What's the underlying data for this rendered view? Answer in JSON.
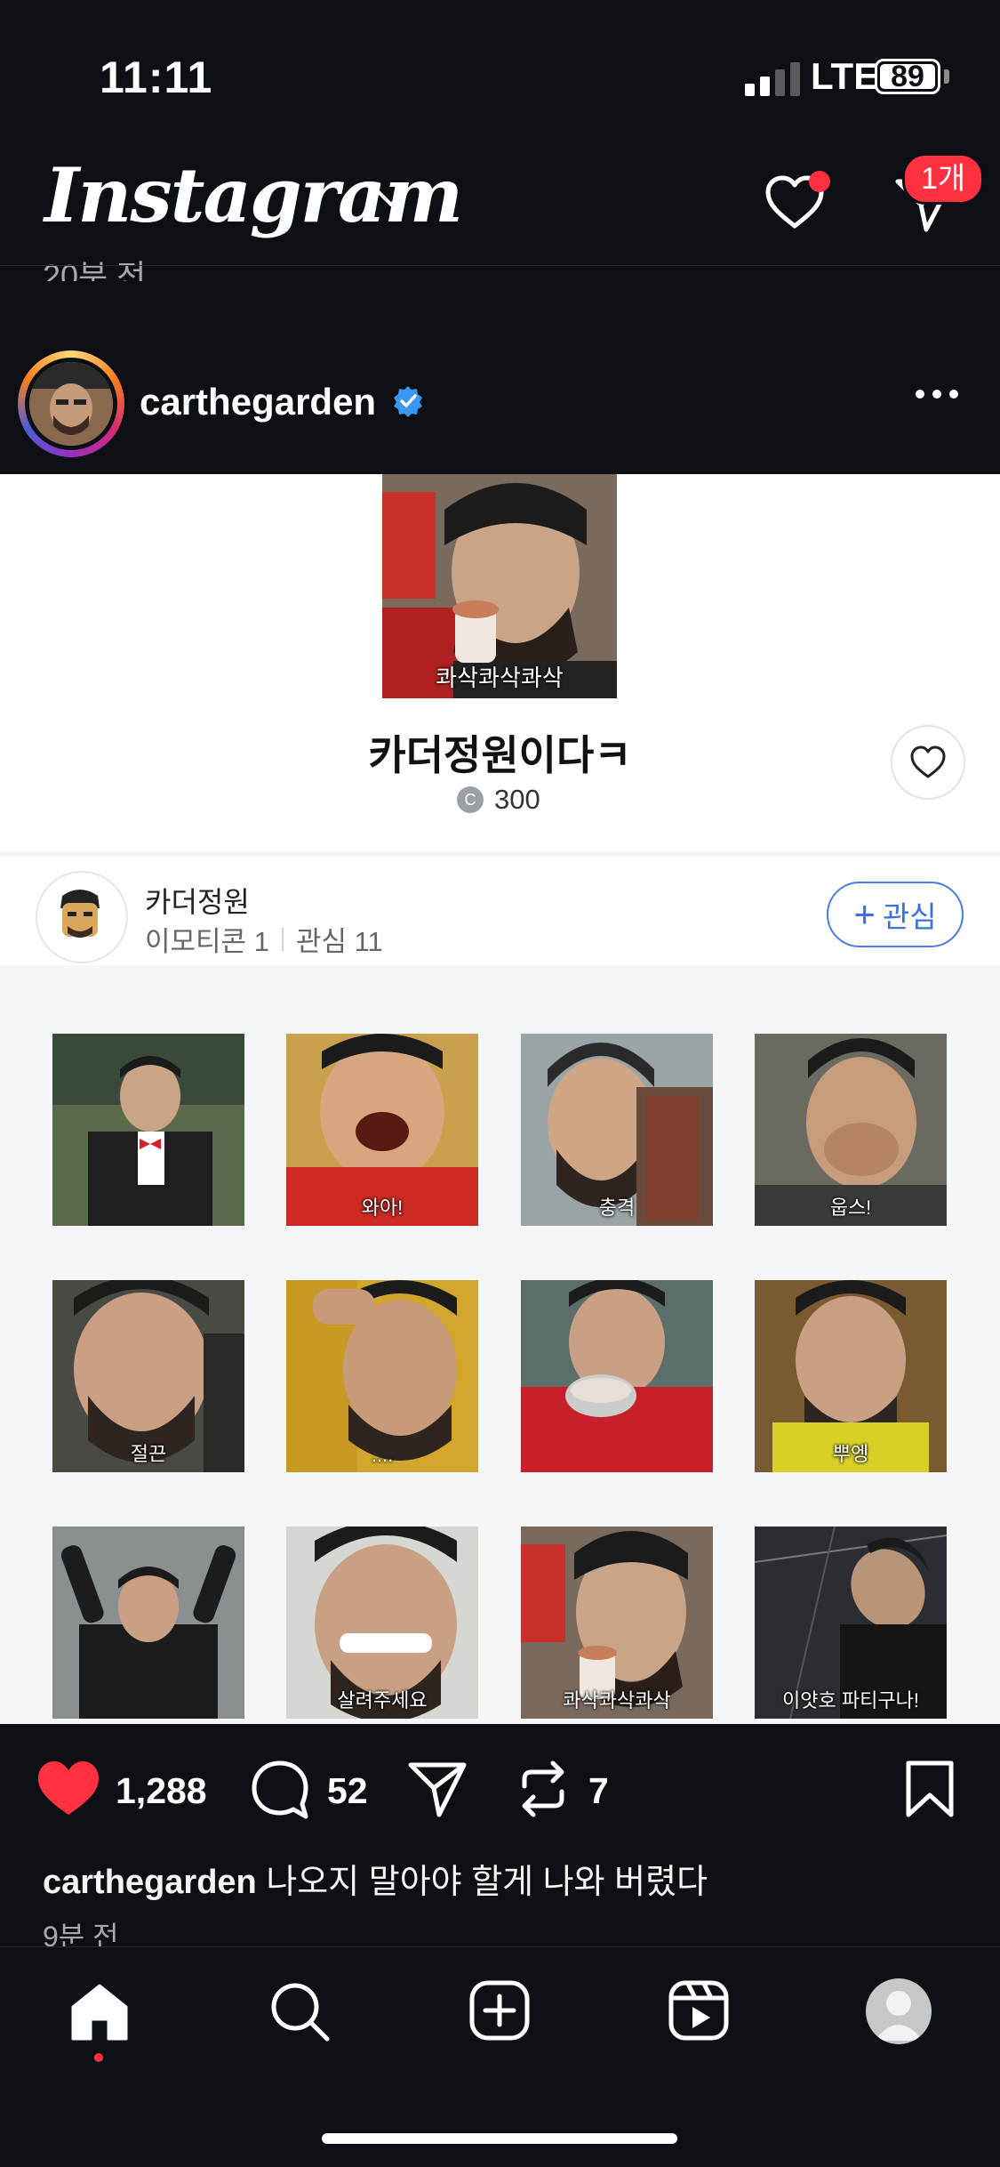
{
  "status_bar": {
    "time": "11:11",
    "network": "LTE",
    "battery": "89"
  },
  "header": {
    "logo": "Instagram",
    "dm_badge": "1개"
  },
  "feed": {
    "previous_post_time": "20분 전"
  },
  "post": {
    "username": "carthegarden",
    "emoticon_card": {
      "hero_caption": "콰삭콰삭콰삭",
      "title": "카더정원이다ㅋ",
      "price": "300",
      "creator_name": "카더정원",
      "creator_meta_emoticons": "이모티콘 1",
      "creator_meta_interest": "관심 11",
      "follow_label": "관심",
      "stickers": [
        {
          "caption": ""
        },
        {
          "caption": "와아!"
        },
        {
          "caption": "충격"
        },
        {
          "caption": "웁스!"
        },
        {
          "caption": "절끈"
        },
        {
          "caption": "...."
        },
        {
          "caption": ""
        },
        {
          "caption": "뿌엥"
        },
        {
          "caption": ""
        },
        {
          "caption": "살려주세요"
        },
        {
          "caption": "콰삭콰삭콰삭"
        },
        {
          "caption": "이얏호 파티구나!"
        }
      ]
    },
    "likes": "1,288",
    "comments": "52",
    "reposts": "7",
    "caption_user": "carthegarden",
    "caption_text": "나오지 말아야 할게 나와 버렸다",
    "time": "9분 전"
  },
  "colors": {
    "background": "#0c1014",
    "like": "#ff3040",
    "accent_blue": "#3b6fe2",
    "verified": "#3897f0"
  }
}
